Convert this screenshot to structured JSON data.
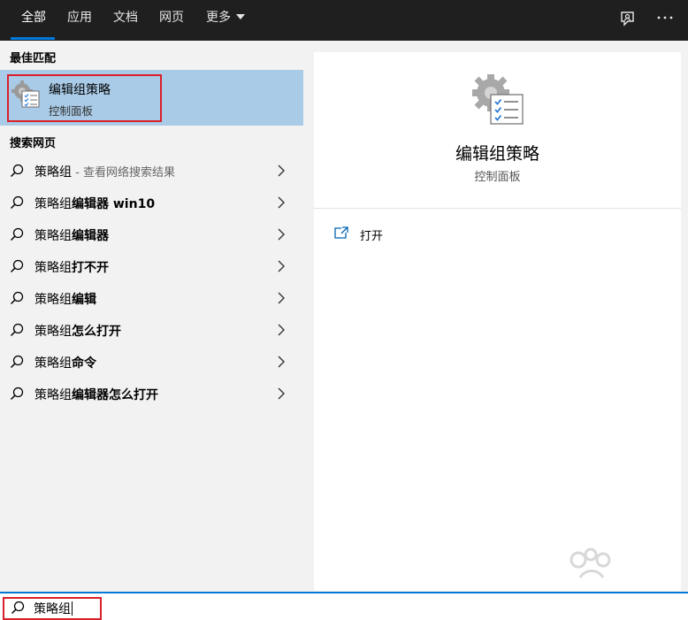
{
  "tabs": [
    {
      "label": "全部",
      "active": true
    },
    {
      "label": "应用"
    },
    {
      "label": "文档"
    },
    {
      "label": "网页"
    },
    {
      "label": "更多"
    }
  ],
  "topbar_icons": [
    "feedback-icon",
    "more-options-icon"
  ],
  "best_match": {
    "section_title": "最佳匹配",
    "title": "编辑组策略",
    "subtitle": "控制面板"
  },
  "web_search": {
    "section_title": "搜索网页",
    "items": [
      {
        "prefix": "策略组",
        "bold": "",
        "note": " - 查看网络搜索结果"
      },
      {
        "prefix": "策略组",
        "bold": "编辑器 win10",
        "note": ""
      },
      {
        "prefix": "策略组",
        "bold": "编辑器",
        "note": ""
      },
      {
        "prefix": "策略组",
        "bold": "打不开",
        "note": ""
      },
      {
        "prefix": "策略组",
        "bold": "编辑",
        "note": ""
      },
      {
        "prefix": "策略组",
        "bold": "怎么打开",
        "note": ""
      },
      {
        "prefix": "策略组",
        "bold": "命令",
        "note": ""
      },
      {
        "prefix": "策略组",
        "bold": "编辑器怎么打开",
        "note": ""
      }
    ]
  },
  "detail": {
    "title": "编辑组策略",
    "subtitle": "控制面板",
    "actions": [
      {
        "label": "打开",
        "icon": "open-icon"
      }
    ]
  },
  "search": {
    "value": "策略组"
  },
  "colors": {
    "accent": "#0078d7",
    "highlight": "#a9cbe7",
    "annotation": "#d9202a",
    "topbar": "#1f1f1f"
  }
}
